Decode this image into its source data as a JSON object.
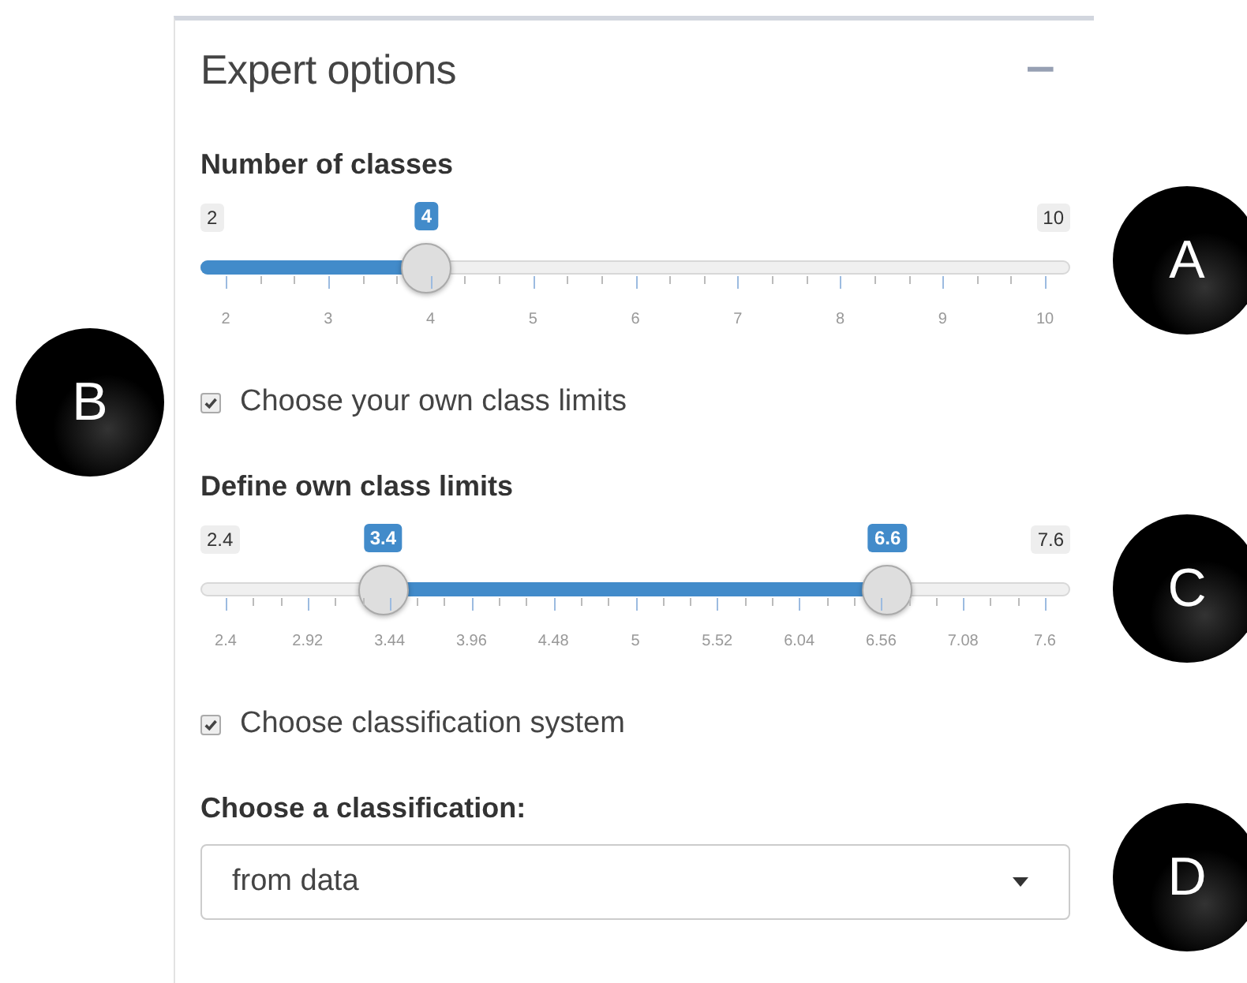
{
  "panel": {
    "title": "Expert options",
    "collapse_symbol": "−"
  },
  "controls": [
    {
      "kind": "slider",
      "label": "Number of classes",
      "min_label": "2",
      "max_label": "10",
      "handles": [
        {
          "value": "4",
          "level": 0.26
        }
      ],
      "grid_labels": [
        "2",
        "3",
        "4",
        "5",
        "6",
        "7",
        "8",
        "9",
        "10"
      ]
    },
    {
      "kind": "checkbox",
      "label": "Choose your own class limits",
      "checked": true
    },
    {
      "kind": "range-slider",
      "label": "Define own class limits",
      "min_label": "2.4",
      "max_label": "7.6",
      "handles": [
        {
          "value": "3.4",
          "level": 0.21
        },
        {
          "value": "6.6",
          "level": 0.79
        }
      ],
      "grid_labels": [
        "2.4",
        "2.92",
        "3.44",
        "3.96",
        "4.48",
        "5",
        "5.52",
        "6.04",
        "6.56",
        "7.08",
        "7.6"
      ]
    },
    {
      "kind": "checkbox",
      "label": "Choose classification system",
      "checked": true
    },
    {
      "kind": "select",
      "label": "Choose a classification:",
      "value": "from data"
    }
  ],
  "callouts": [
    {
      "letter": "A"
    },
    {
      "letter": "B"
    },
    {
      "letter": "C"
    },
    {
      "letter": "D"
    }
  ]
}
